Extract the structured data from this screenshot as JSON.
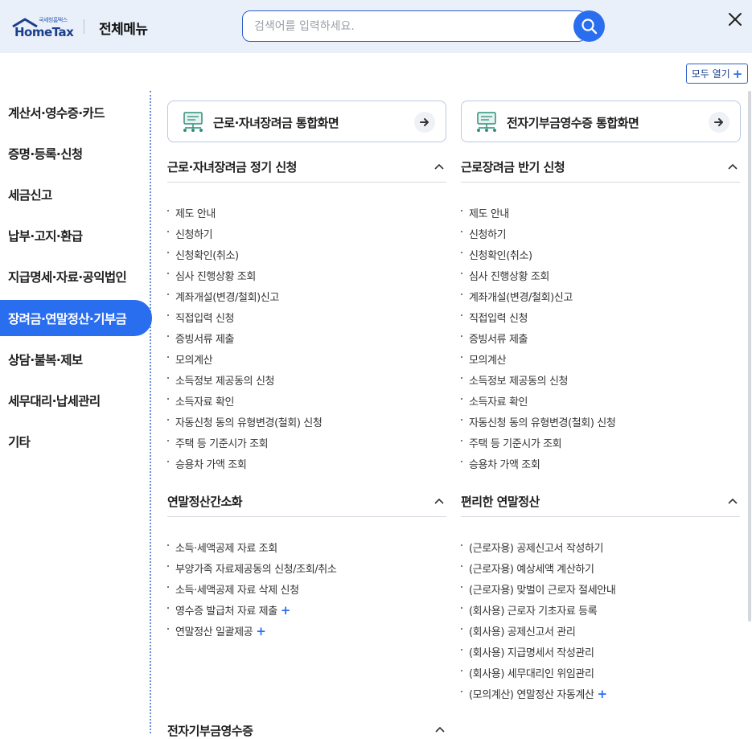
{
  "header": {
    "logo_small": "국세청홈택스",
    "logo_main": "HomeTax",
    "menu_title": "전체메뉴",
    "search_placeholder": "검색어를 입력하세요.",
    "search_icon": "search-icon",
    "close_icon": "close-icon"
  },
  "toolbar": {
    "open_all_label": "모두 열기",
    "open_all_icon": "+"
  },
  "sidebar": {
    "items": [
      {
        "label": "계산서·영수증·카드",
        "active": false
      },
      {
        "label": "증명·등록·신청",
        "active": false
      },
      {
        "label": "세금신고",
        "active": false
      },
      {
        "label": "납부·고지·환급",
        "active": false
      },
      {
        "label": "지급명세·자료·공익법인",
        "active": false
      },
      {
        "label": "장려금·연말정산·기부금",
        "active": true
      },
      {
        "label": "상담·불복·제보",
        "active": false
      },
      {
        "label": "세무대리·납세관리",
        "active": false
      },
      {
        "label": "기타",
        "active": false
      }
    ]
  },
  "quick_links": [
    {
      "label": "근로·자녀장려금 통합화면",
      "icon": "computer-network-icon",
      "arrow": "arrow-right-icon"
    },
    {
      "label": "전자기부금영수증 통합화면",
      "icon": "computer-network-icon",
      "arrow": "arrow-right-icon"
    }
  ],
  "sections": [
    {
      "title": "근로·자녀장려금 정기 신청",
      "items": [
        "제도 안내",
        "신청하기",
        "신청확인(취소)",
        "심사 진행상황 조회",
        "계좌개설(변경/철회)신고",
        "직접입력 신청",
        "증빙서류 제출",
        "모의계산",
        "소득정보 제공동의 신청",
        "소득자료 확인",
        "자동신청 동의 유형변경(철회) 신청",
        "주택 등 기준시가 조회",
        "승용차 가액 조회"
      ]
    },
    {
      "title": "근로장려금 반기 신청",
      "items": [
        "제도 안내",
        "신청하기",
        "신청확인(취소)",
        "심사 진행상황 조회",
        "계좌개설(변경/철회)신고",
        "직접입력 신청",
        "증빙서류 제출",
        "모의계산",
        "소득정보 제공동의 신청",
        "소득자료 확인",
        "자동신청 동의 유형변경(철회) 신청",
        "주택 등 기준시가 조회",
        "승용차 가액 조회"
      ]
    },
    {
      "title": "연말정산간소화",
      "items": [
        "소득·세액공제 자료 조회",
        "부양가족 자료제공동의 신청/조회/취소",
        "소득·세액공제 자료 삭제 신청",
        "영수증 발급처 자료 제출",
        "연말정산 일괄제공"
      ],
      "plus_items": [
        3,
        4
      ]
    },
    {
      "title": "편리한 연말정산",
      "items": [
        "(근로자용) 공제신고서 작성하기",
        "(근로자용) 예상세액 계산하기",
        "(근로자용) 맞벌이 근로자 절세안내",
        "(회사용) 근로자 기초자료 등록",
        "(회사용) 공제신고서 관리",
        "(회사용) 지급명세서 작성관리",
        "(회사용) 세무대리인 위임관리",
        "(모의계산) 연말정산 자동계산"
      ],
      "plus_items": [
        7
      ]
    },
    {
      "title": "전자기부금영수증",
      "items": []
    }
  ],
  "colors": {
    "accent": "#2a6ef0",
    "header_bg": "#eaf0f9",
    "brand": "#1a3f8c"
  }
}
